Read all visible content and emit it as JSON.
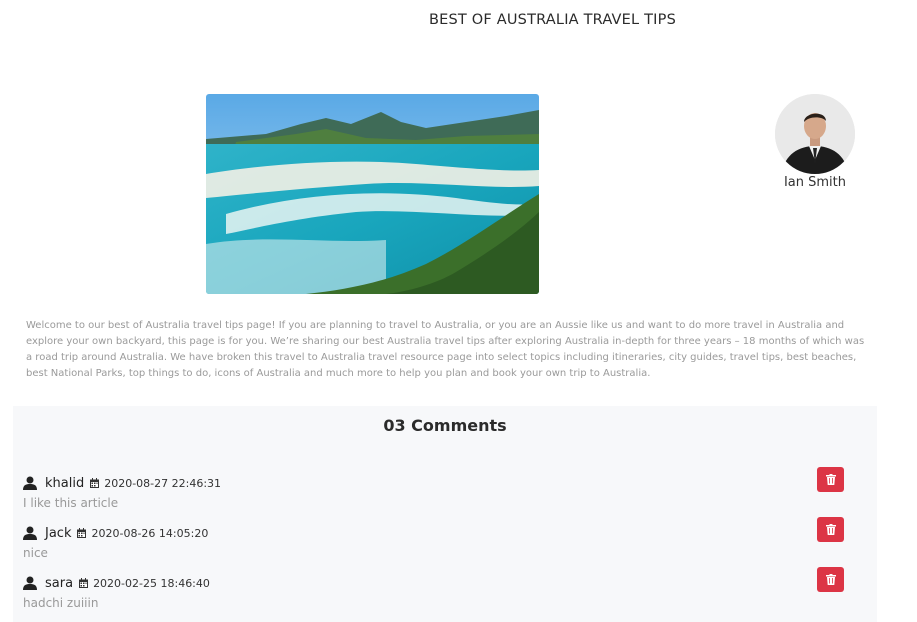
{
  "article": {
    "title": "BEST OF AUSTRALIA TRAVEL TIPS",
    "author": "Ian Smith",
    "body": "Welcome to our best of Australia travel tips page! If you are planning to travel to Australia, or you are an Aussie like us and want to do more travel in Australia and explore your own backyard, this page is for you. We’re sharing our best Australia travel tips after exploring Australia in-depth for three years – 18 months of which was a road trip around Australia. We have broken this travel to Australia travel resource page into select topics including itineraries, city guides, travel tips, best beaches, best National Parks, top things to do, icons of Australia and much more to help you plan and book your own trip to Australia."
  },
  "comments": {
    "title": "03 Comments",
    "items": [
      {
        "author": "khalid",
        "date": "2020-08-27 22:46:31",
        "text": "I like this article"
      },
      {
        "author": "Jack",
        "date": "2020-08-26 14:05:20",
        "text": "nice"
      },
      {
        "author": "sara",
        "date": "2020-02-25 18:46:40",
        "text": "hadchi zuiiin"
      }
    ]
  },
  "colors": {
    "delete": "#dc3545",
    "panel": "#f7f8fa",
    "muted_text": "#999999"
  }
}
